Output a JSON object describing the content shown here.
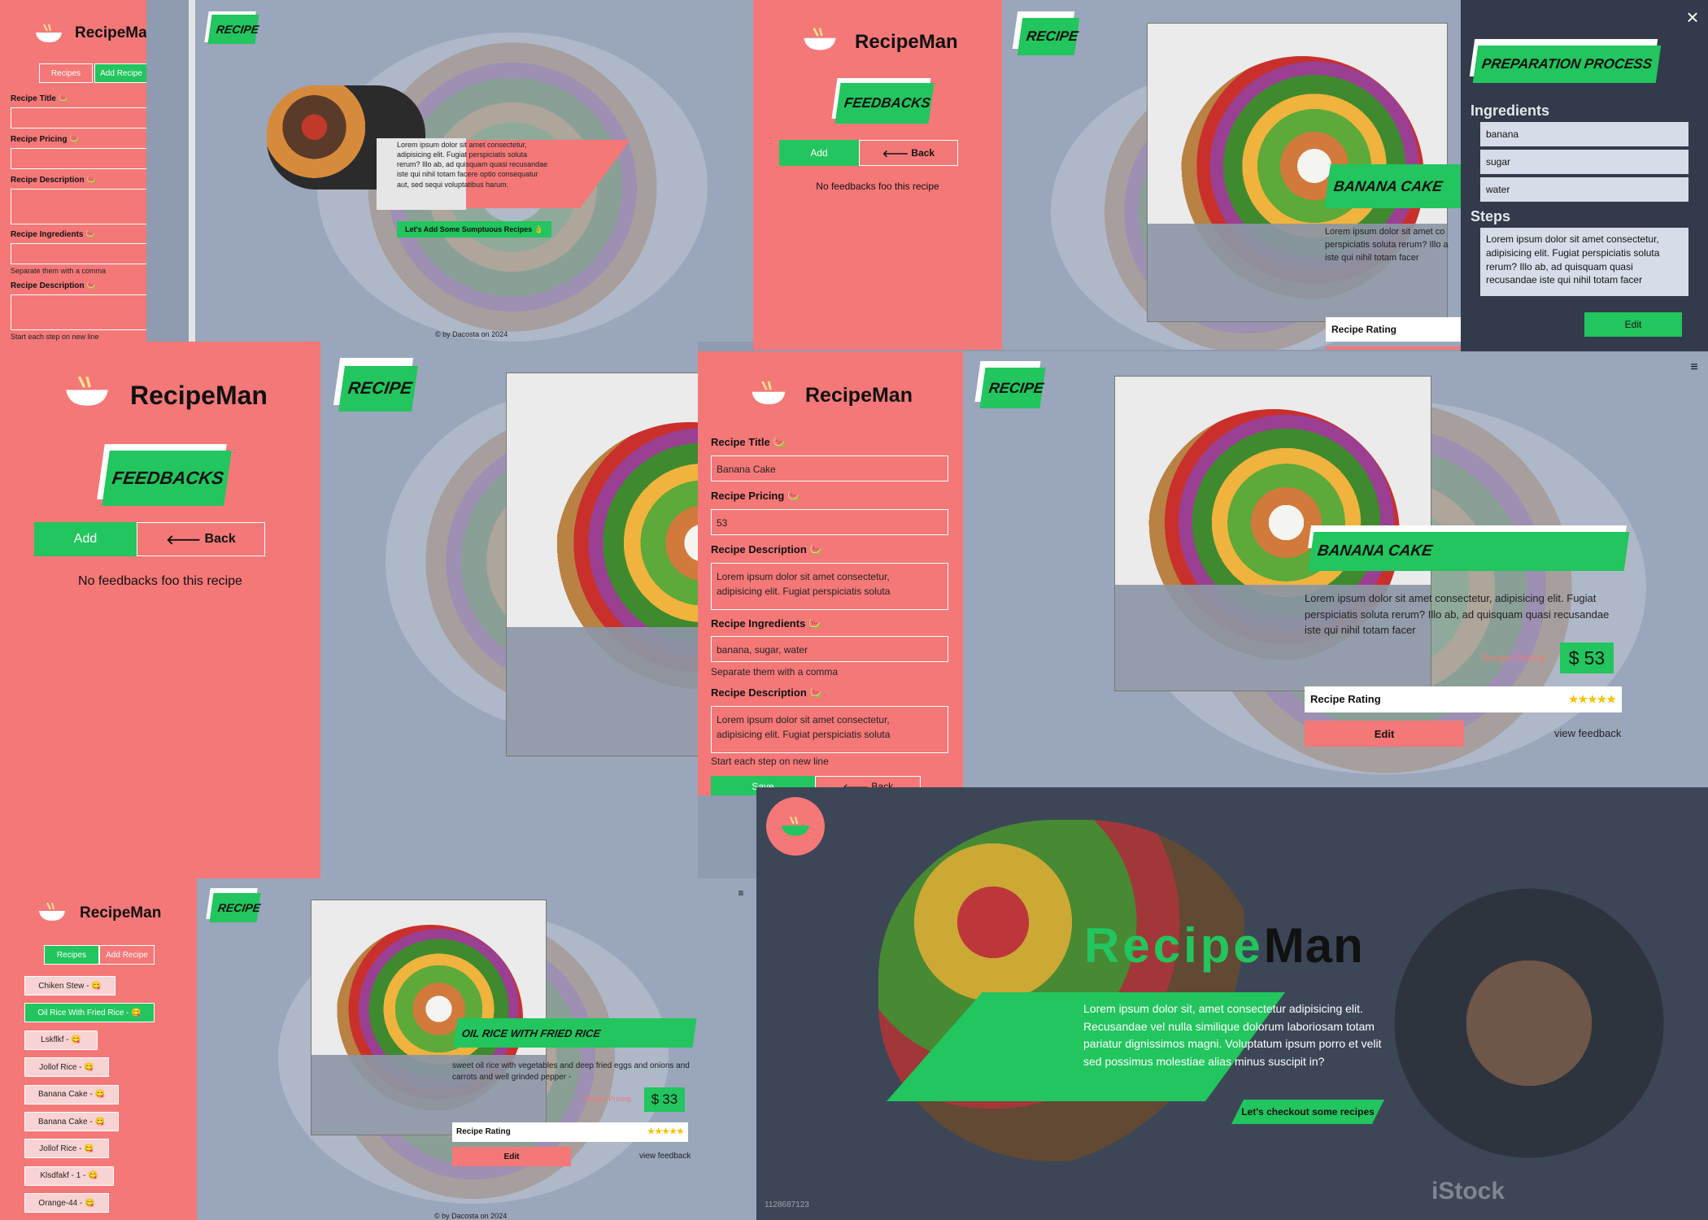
{
  "brand": "RecipeMan",
  "colors": {
    "coral": "#f47878",
    "green": "#22c55e",
    "slate": "#9aa6bb",
    "dark": "#323a4b"
  },
  "add_form": {
    "tabs": [
      "Recipes",
      "Add Recipe"
    ],
    "fields": [
      {
        "label": "Recipe Title",
        "value": ""
      },
      {
        "label": "Recipe Pricing",
        "value": ""
      },
      {
        "label": "Recipe Description",
        "value": ""
      },
      {
        "label": "Recipe Ingredients",
        "value": "",
        "hint": "Separate them with a comma"
      },
      {
        "label": "Recipe Description",
        "value": "",
        "hint": "Start each step on new line"
      }
    ]
  },
  "recipe_tag": "RECIPE",
  "hero_card": {
    "text": "Lorem ipsum dolor sit amet consectetur, adipisicing elit. Fugiat perspiciatis soluta rerum? Illo ab, ad quisquam quasi recusandae iste qui nihil totam facere optio consequatur aut, sed sequi voluptatibus harum.",
    "cta": "Let's Add Some Sumptuous Recipes 👌"
  },
  "footer": "by Dacosta on 2024",
  "feedback": {
    "title": "FEEDBACKS",
    "add": "Add",
    "back": "Back",
    "empty": "No feedbacks foo this recipe"
  },
  "recipe_detail": {
    "name": "BANANA CAKE",
    "description": "Lorem ipsum dolor sit amet consectetur, adipisicing elit. Fugiat perspiciatis soluta rerum? Illo ab, ad quisquam quasi recusandae iste qui nihil totam facer",
    "description_short": "Lorem ipsum dolor sit amet co perspiciatis soluta rerum? Illo a iste qui nihil totam facer",
    "pricing_label": "Recipe Pricing",
    "currency": "$",
    "price": "53",
    "rating_label": "Recipe Rating",
    "rating": 5,
    "edit": "Edit",
    "view_feedback": "view feedback"
  },
  "prep": {
    "title": "PREPARATION PROCESS",
    "ingredients_heading": "Ingredients",
    "ingredients": [
      "banana",
      "sugar",
      "water"
    ],
    "steps_heading": "Steps",
    "steps_text": "Lorem ipsum dolor sit amet consectetur, adipisicing elit. Fugiat perspiciatis soluta rerum? Illo ab, ad quisquam quasi recusandae iste qui nihil totam facer",
    "edit": "Edit",
    "close": "×"
  },
  "edit_form": {
    "fields": [
      {
        "label": "Recipe Title",
        "value": "Banana Cake"
      },
      {
        "label": "Recipe Pricing",
        "value": "53"
      },
      {
        "label": "Recipe Description",
        "value": "Lorem ipsum dolor sit amet consectetur, adipisicing elit. Fugiat perspiciatis soluta"
      },
      {
        "label": "Recipe Ingredients",
        "value": "banana, sugar, water",
        "hint": "Separate them with a comma"
      },
      {
        "label": "Recipe Description",
        "value": "Lorem ipsum dolor sit amet consectetur, adipisicing elit. Fugiat perspiciatis soluta",
        "hint": "Start each step on new line"
      }
    ],
    "save": "Save",
    "back": "Back"
  },
  "recipe_list": {
    "tabs": [
      "Recipes",
      "Add Recipe"
    ],
    "items": [
      "Chiken Stew - 😋",
      "Oil Rice With Fried Rice - 😋",
      "Lskflkf - 😋",
      "Jollof Rice - 😋",
      "Banana Cake - 😋",
      "Banana Cake - 😋",
      "Jollof Rice - 😋",
      "Klsdfakf - 1 - 😋",
      "Orange-44 - 😋"
    ],
    "selected": 1
  },
  "recipe_detail2": {
    "name": "OIL RICE WITH FRIED RICE",
    "description": "sweet oil rice with vegetables and deep fried eggs and onions and carrots and well grinded pepper -",
    "pricing_label": "Recipe Pricing",
    "currency": "$",
    "price": "33",
    "rating_label": "Recipe Rating",
    "rating": 5,
    "edit": "Edit",
    "view_feedback": "view feedback"
  },
  "landing": {
    "title_a": "Recipe",
    "title_b": "Man",
    "text": "Lorem ipsum dolor sit, amet consectetur adipisicing elit. Recusandae vel nulla similique dolorum laboriosam totam pariatur dignissimos magni. Voluptatum ipsum porro et velit sed possimus molestiae alias minus suscipit in?",
    "cta": "Let's checkout some recipes",
    "watermark": "iStock",
    "stock_id": "1128687123"
  }
}
